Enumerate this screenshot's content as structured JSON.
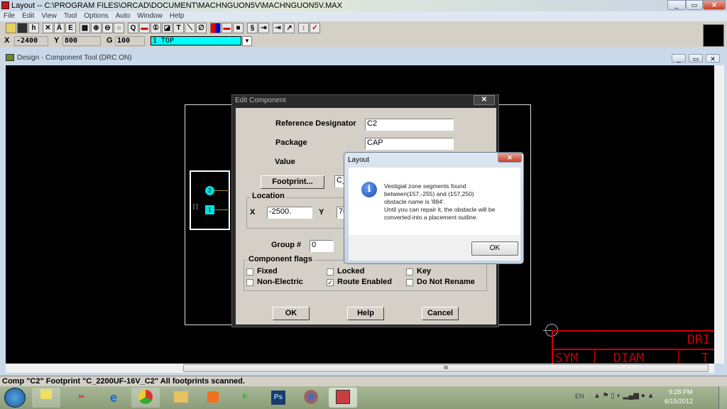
{
  "app": {
    "title": "Layout -- C:\\PROGRAM FILES\\ORCAD\\DOCUMENT\\MACHNGUON5V\\MACHNGUON5V.MAX"
  },
  "menu": [
    "File",
    "Edit",
    "View",
    "Tool",
    "Options",
    "Auto",
    "Window",
    "Help"
  ],
  "coords": {
    "x_label": "X",
    "x": "-2400",
    "y_label": "Y",
    "y": "800",
    "g_label": "G",
    "g": "100",
    "layer": "1 TOP"
  },
  "child": {
    "title": "Design - Component Tool (DRC ON)"
  },
  "canvas": {
    "pad1": "2",
    "pad2": "1",
    "table_title": "DRI",
    "col1": "SYM",
    "col2": "DIAM",
    "col3": "T"
  },
  "edit_component": {
    "title": "Edit Component",
    "ref_label": "Reference Designator",
    "ref": "C2",
    "package_label": "Package",
    "package": "CAP",
    "value_label": "Value",
    "footprint_button": "Footprint...",
    "footprint": "C_",
    "location_label": "Location",
    "x_label": "X",
    "x": "-2500.",
    "y_label": "Y",
    "y": "70",
    "group_label": "Group #",
    "group": "0",
    "flags_label": "Component flags",
    "flags": [
      {
        "label": "Fixed",
        "checked": false
      },
      {
        "label": "Locked",
        "checked": false
      },
      {
        "label": "Key",
        "checked": false
      },
      {
        "label": "Non-Electric",
        "checked": false
      },
      {
        "label": "Route Enabled",
        "checked": true
      },
      {
        "label": "Do Not Rename",
        "checked": false
      }
    ],
    "ok": "OK",
    "help": "Help",
    "cancel": "Cancel"
  },
  "message": {
    "title": "Layout",
    "lines": [
      "Vestigial zone segments found",
      "between(157,-255) and (157,250)",
      "obstacle name is '884'.",
      "Until you can repair it, the obstacle will be",
      "converted into a placement outline."
    ],
    "ok": "OK"
  },
  "status": "Comp \"C2\" Footprint \"C_2200UF-16V_C2\"   All footprints scanned.",
  "taskbar": {
    "lang": "EN",
    "time": "9:28 PM",
    "date": "6/15/2012",
    "apps": [
      "Sticky Notes",
      "Snipping Tool",
      "Internet Explorer",
      "Chrome",
      "Explorer",
      "Media Player",
      "FlashGet",
      "Ps",
      "Firefox",
      "Layout"
    ]
  }
}
